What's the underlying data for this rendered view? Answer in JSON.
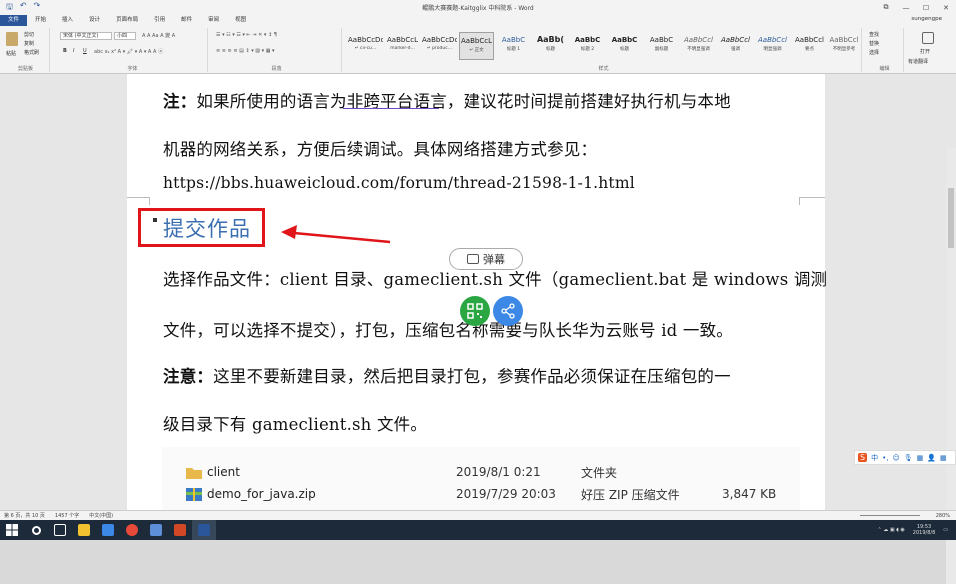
{
  "window": {
    "title": "鲲鹏大赛赛题-Kaitgglix 中科院系 - Word",
    "user": "sungengpe"
  },
  "quick_access": {
    "save": "🖫",
    "undo": "↶",
    "redo": "↷"
  },
  "window_controls": {
    "restore": "⧉",
    "minimize": "—",
    "maximize": "☐",
    "close": "✕"
  },
  "tabs": [
    "文件",
    "开始",
    "插入",
    "设计",
    "页面布局",
    "引用",
    "邮件",
    "审阅",
    "视图"
  ],
  "ribbon": {
    "clipboard": {
      "paste": "粘贴",
      "cut": "剪切",
      "copy": "复制",
      "format_painter": "格式刷",
      "group": "剪贴板"
    },
    "font": {
      "name": "宋体 (中文正文)",
      "size": "小四",
      "group": "字体",
      "bold": "B",
      "italic": "I",
      "underline": "U"
    },
    "paragraph": {
      "group": "段落"
    },
    "styles": {
      "group": "样式",
      "items": [
        {
          "preview": "AaBbCcDc",
          "name": "↵ cii-cu..."
        },
        {
          "preview": "AaBbCcL",
          "name": "marker-d..."
        },
        {
          "preview": "AaBbCcDc",
          "name": "↵ produc..."
        },
        {
          "preview": "AaBbCcL",
          "name": "↵ 正文"
        },
        {
          "preview": "AaBbC",
          "name": "标题 1"
        },
        {
          "preview": "AaBb(",
          "name": "标题"
        },
        {
          "preview": "AaBbC",
          "name": "标题 2"
        },
        {
          "preview": "AaBbC",
          "name": "标题"
        },
        {
          "preview": "AaBbC",
          "name": "副标题"
        },
        {
          "preview": "AaBbCcl",
          "name": "不明显强调"
        },
        {
          "preview": "AaBbCcl",
          "name": "强调"
        },
        {
          "preview": "AaBbCcl",
          "name": "明显强调"
        },
        {
          "preview": "AaBbCcl",
          "name": "要点"
        },
        {
          "preview": "AaBbCcl",
          "name": "不明显参考"
        }
      ]
    },
    "editing": {
      "find": "查找",
      "replace": "替换",
      "select": "选择",
      "group": "编辑"
    },
    "extra": {
      "label": "打开",
      "sub": "有道翻译"
    }
  },
  "document": {
    "p1_bold": "注：",
    "p1_text": "如果所使用的语言为非跨平台语言，建议花时间提前搭建好执行机与本地",
    "p2": "机器的网络关系，方便后续调试。具体网络搭建方式参见：",
    "p3": "https://bbs.huaweicloud.com/forum/thread-21598-1-1.html",
    "heading": "提交作品",
    "p4": "选择作品文件：client 目录、gameclient.sh 文件（gameclient.bat 是 windows 调测",
    "p5": "文件，可以选择不提交），打包，压缩包名称需要与队长华为云账号 id 一致。",
    "p6_bold": "注意：",
    "p6_text": "这里不要新建目录，然后把目录打包，参赛作品必须保证在压缩包的一",
    "p7": "级目录下有 gameclient.sh 文件。"
  },
  "overlay": {
    "danmu": "弹幕"
  },
  "files": [
    {
      "name": "client",
      "date": "2019/8/1 0:21",
      "type": "文件夹",
      "size": "",
      "icon": "folder-icon"
    },
    {
      "name": "demo_for_java.zip",
      "date": "2019/7/29 20:03",
      "type": "好压 ZIP 压缩文件",
      "size": "3,847 KB",
      "icon": "zip-icon"
    }
  ],
  "ime": {
    "logo": "S",
    "label": "中"
  },
  "status": {
    "page": "第 6 页，共 10 页",
    "words": "1457 个字",
    "lang": "中文(中国)",
    "zoom": "280%"
  },
  "clock": {
    "time": "19:53",
    "date": "2019/8/8"
  },
  "colors": {
    "accent": "#2b579a",
    "heading": "#3b6fb0",
    "annotation": "#e0151a",
    "wechat": "#2aa743",
    "share": "#3b88e6"
  }
}
